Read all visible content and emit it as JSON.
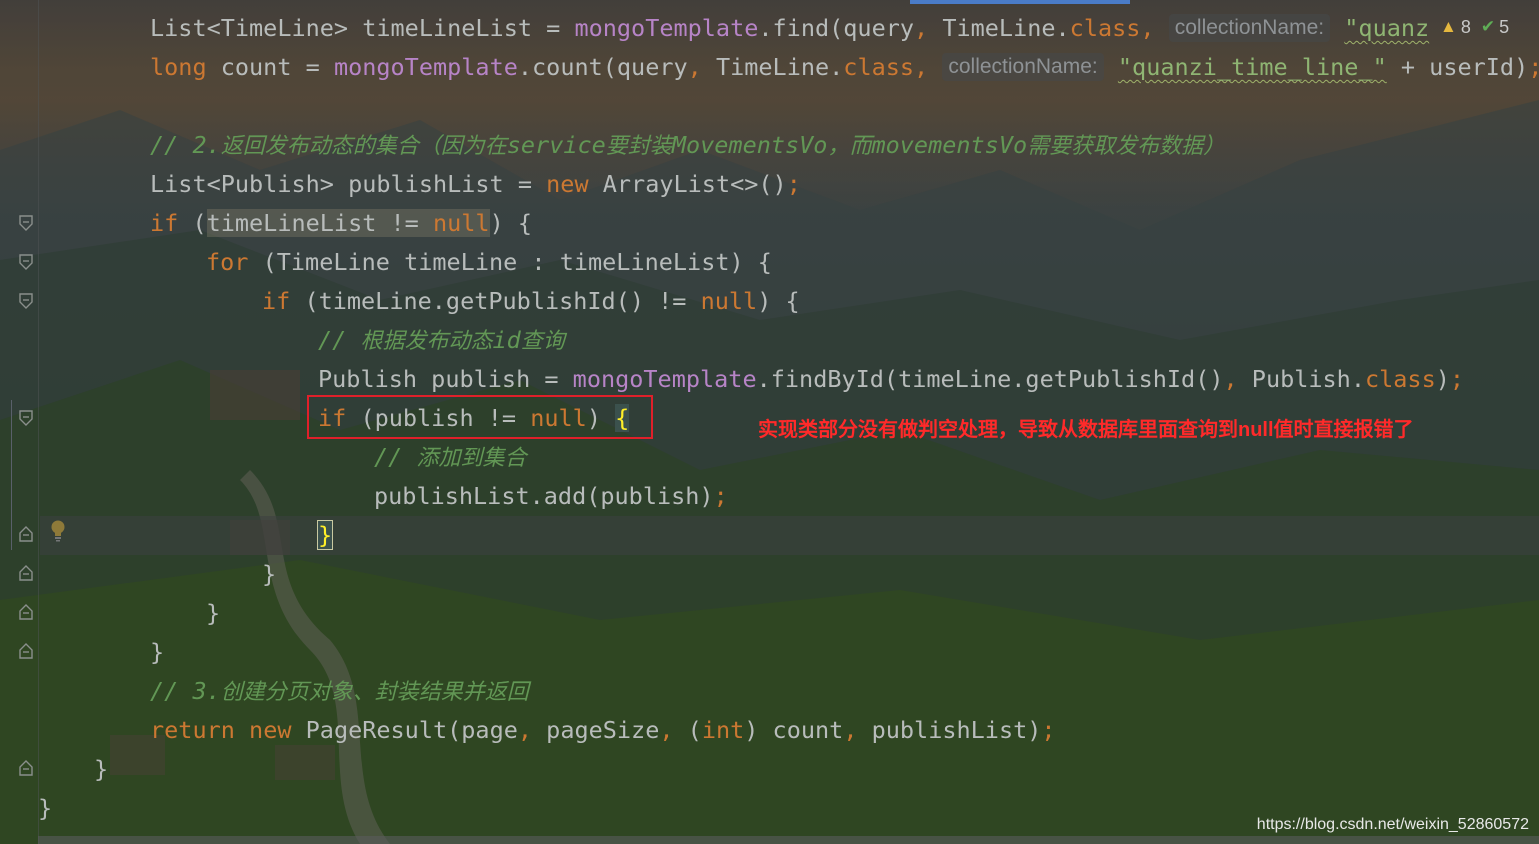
{
  "code": {
    "l1": {
      "a": "List<TimeLine> timeLineList = ",
      "b": "mongoTemplate",
      "c": ".find(query",
      "d": ", ",
      "e": "TimeLine.",
      "f": "class",
      "g": ", ",
      "hint": "collectionName:",
      "str": "\"quanz"
    },
    "l2": {
      "kw": "long",
      "a": " count = ",
      "b": "mongoTemplate",
      "c": ".count(query",
      "d": ", ",
      "e": "TimeLine.",
      "f": "class",
      "g": ", ",
      "hint": "collectionName:",
      "str": "\"quanzi_time_line_\"",
      "h": " + userId)",
      "i": ";"
    },
    "l4": {
      "prefix": "// 2.",
      "t1": "返回发布动态的集合（因为在",
      "c1": "service",
      "t2": "要封装",
      "c2": "MovementsVo",
      "t3": "，而",
      "c3": "movementsVo",
      "t4": "需要获取发布数据）"
    },
    "l5": {
      "a": "List<Publish> publishList = ",
      "kw": "new",
      "b": " ArrayList<>()",
      "c": ";"
    },
    "l6": {
      "kw": "if",
      "a": " (",
      "b": "timeLineList != ",
      "null": "null",
      "c": ") {"
    },
    "l7": {
      "kw": "for",
      "a": " (TimeLine timeLine : timeLineList) {"
    },
    "l8": {
      "kw": "if",
      "a": " (timeLine.getPublishId() != ",
      "null": "null",
      "b": ") {"
    },
    "l9": {
      "prefix": "// ",
      "t1": "根据发布动态",
      "c1": "id",
      "t2": "查询"
    },
    "l10": {
      "a": "Publish publish = ",
      "b": "mongoTemplate",
      "c": ".findById(timeLine.getPublishId()",
      "d": ", ",
      "e": "Publish.",
      "f": "class",
      "g": ")",
      "h": ";"
    },
    "l11": {
      "kw": "if",
      "a": " (publish != ",
      "null": "null",
      "b": ") ",
      "brace": "{"
    },
    "l12": {
      "prefix": "// ",
      "t1": "添加到集合"
    },
    "l13": {
      "a": "publishList.add(publish)",
      "b": ";"
    },
    "l14": {
      "brace": "}"
    },
    "l15": {
      "a": "}"
    },
    "l16": {
      "a": "}"
    },
    "l17": {
      "a": "}"
    },
    "l18": {
      "prefix": "// 3.",
      "t1": "创建分页对象、封装结果并返回"
    },
    "l19": {
      "kw": "return",
      "kw2": "new",
      "a": " PageResult(page",
      "d1": ", ",
      "b": "pageSize",
      "d2": ", ",
      "c": "(",
      "kw3": "int",
      "e": ") count",
      "d3": ", ",
      "f": "publishList)",
      "g": ";"
    },
    "l20": {
      "a": "}"
    },
    "l21": {
      "a": "}"
    }
  },
  "inspections": {
    "warnings": "8",
    "ok": "5"
  },
  "annotation": "实现类部分没有做判空处理，导致从数据库里面查询到null值时直接报错了",
  "watermark": "https://blog.csdn.net/weixin_52860572",
  "icons": {
    "fold": "fold-marker-icon",
    "bulb": "lightbulb-icon",
    "warning": "warning-triangle-icon",
    "check": "double-check-icon"
  },
  "colors": {
    "keyword": "#cc7832",
    "field": "#b784c7",
    "string": "#8fb573",
    "comment": "#629755",
    "annotation": "#ff2a2a",
    "box": "#e0202a"
  }
}
